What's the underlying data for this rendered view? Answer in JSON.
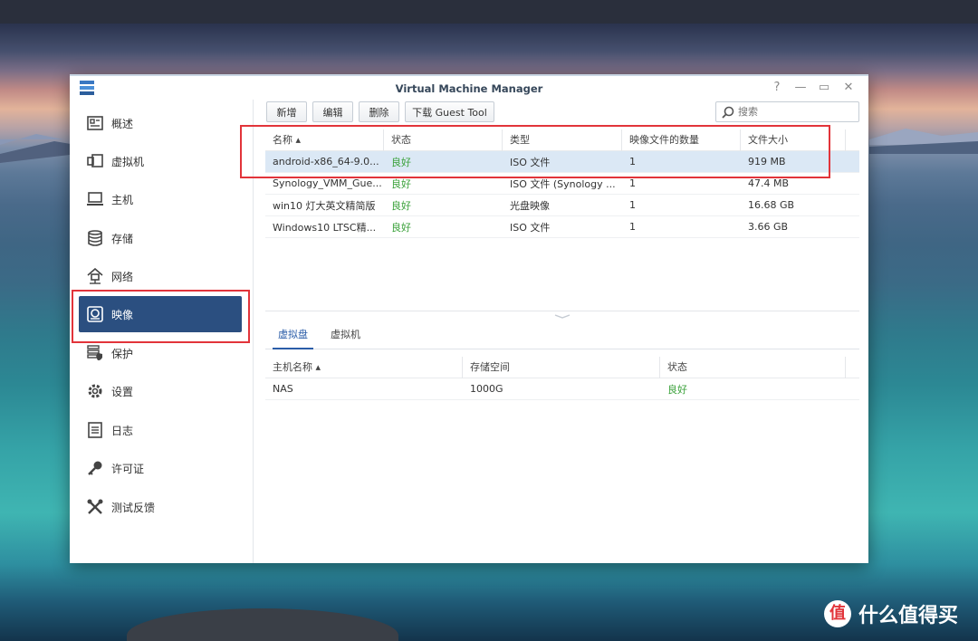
{
  "window": {
    "title": "Virtual Machine Manager"
  },
  "sidebar": {
    "items": [
      {
        "label": "概述",
        "icon": "overview-icon"
      },
      {
        "label": "虚拟机",
        "icon": "virtual-machine-icon"
      },
      {
        "label": "主机",
        "icon": "host-icon"
      },
      {
        "label": "存储",
        "icon": "storage-icon"
      },
      {
        "label": "网络",
        "icon": "network-icon"
      },
      {
        "label": "映像",
        "icon": "image-icon",
        "active": true
      },
      {
        "label": "保护",
        "icon": "protection-icon"
      },
      {
        "label": "设置",
        "icon": "gear-icon"
      },
      {
        "label": "日志",
        "icon": "log-icon"
      },
      {
        "label": "许可证",
        "icon": "key-icon"
      },
      {
        "label": "测试反馈",
        "icon": "tools-icon"
      }
    ]
  },
  "toolbar": {
    "new_label": "新增",
    "edit_label": "编辑",
    "delete_label": "删除",
    "download_label": "下载 Guest Tool",
    "search_placeholder": "搜索"
  },
  "images_table": {
    "headers": [
      "名称 ▴",
      "状态",
      "类型",
      "映像文件的数量",
      "文件大小"
    ],
    "rows": [
      [
        "android-x86_64-9.0...",
        "良好",
        "ISO 文件",
        "1",
        "919 MB"
      ],
      [
        "Synology_VMM_Gue...",
        "良好",
        "ISO 文件 (Synology ...",
        "1",
        "47.4 MB"
      ],
      [
        "win10 灯大英文精简版",
        "良好",
        "光盘映像",
        "1",
        "16.68 GB"
      ],
      [
        "Windows10 LTSC精...",
        "良好",
        "ISO 文件",
        "1",
        "3.66 GB"
      ]
    ]
  },
  "detail_tabs": {
    "disk_label": "虚拟盘",
    "vm_label": "虚拟机"
  },
  "disk_table": {
    "headers": [
      "主机名称 ▴",
      "存储空间",
      "状态"
    ],
    "rows": [
      [
        "NAS",
        "1000G",
        "良好"
      ]
    ]
  },
  "watermark": {
    "text": "什么值得买",
    "badge": "值"
  },
  "colors": {
    "active_nav": "#2b4f80",
    "status_ok": "#3aa13a",
    "highlight": "#e2343a",
    "selected_row": "#dbe8f5"
  }
}
